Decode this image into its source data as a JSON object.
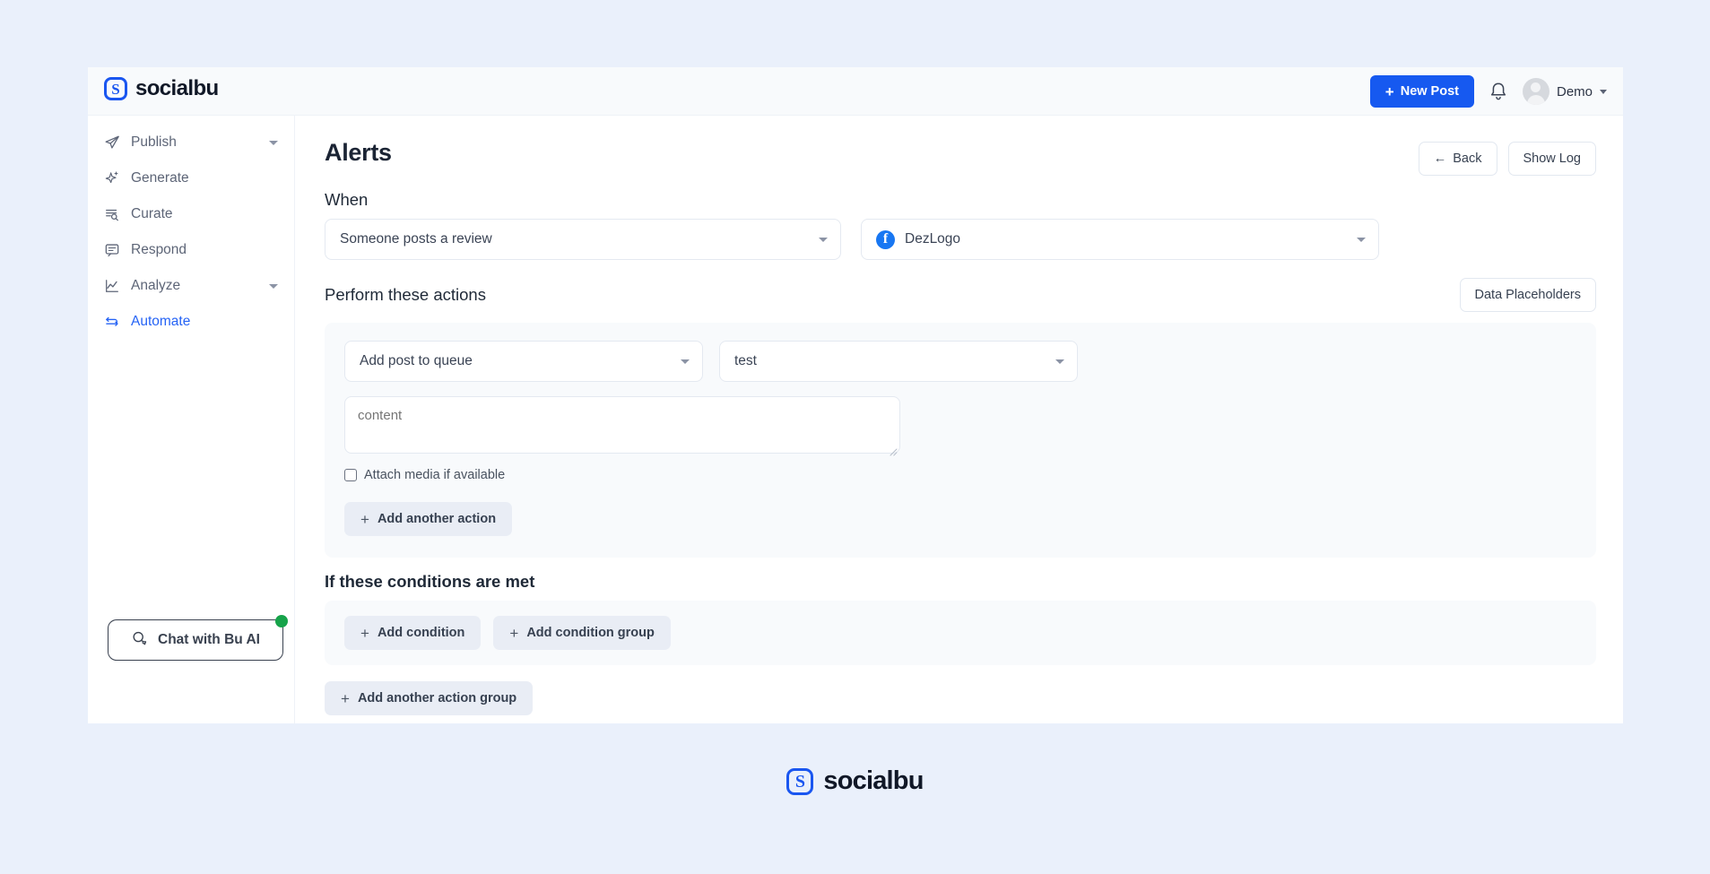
{
  "brand": {
    "name": "socialbu",
    "mark_glyph": "S"
  },
  "topbar": {
    "new_post_label": "New Post",
    "new_post_plus": "+",
    "user_name": "Demo",
    "notifications_icon": "bell-icon"
  },
  "sidebar": {
    "items": [
      {
        "label": "Publish",
        "icon": "paper-plane-icon",
        "active": false,
        "expandable": true
      },
      {
        "label": "Generate",
        "icon": "sparkle-icon",
        "active": false,
        "expandable": false
      },
      {
        "label": "Curate",
        "icon": "list-search-icon",
        "active": false,
        "expandable": false
      },
      {
        "label": "Respond",
        "icon": "chat-box-icon",
        "active": false,
        "expandable": false
      },
      {
        "label": "Analyze",
        "icon": "line-chart-icon",
        "active": false,
        "expandable": true
      },
      {
        "label": "Automate",
        "icon": "loop-arrows-icon",
        "active": true,
        "expandable": false
      }
    ],
    "chat_widget": {
      "label": "Chat with Bu AI",
      "icon": "chat-bubbles-icon",
      "status_dot_color": "#16a34a"
    }
  },
  "page": {
    "title": "Alerts",
    "back_label": "Back",
    "back_arrow": "←",
    "show_log_label": "Show Log"
  },
  "when": {
    "label": "When",
    "trigger_value": "Someone posts a review",
    "account_value": "DezLogo",
    "account_icon": "facebook-icon",
    "account_icon_glyph": "f"
  },
  "actions": {
    "label": "Perform these actions",
    "data_placeholders_label": "Data Placeholders",
    "action_value": "Add post to queue",
    "queue_value": "test",
    "content_placeholder": "content",
    "content_value": "",
    "attach_media_label": "Attach media if available",
    "attach_media_checked": false,
    "add_another_action_label": "Add another action",
    "plus": "+"
  },
  "conditions": {
    "label": "If these conditions are met",
    "add_condition_label": "Add condition",
    "add_condition_group_label": "Add condition group",
    "plus": "+"
  },
  "footer_actions": {
    "add_another_action_group_label": "Add another action group",
    "plus": "+"
  },
  "footer": {
    "brand_name": "socialbu",
    "mark_glyph": "S"
  },
  "colors": {
    "accent": "#1659f0",
    "page_background": "#eaf0fb",
    "panel_background": "#f8fafc",
    "active_nav": "#2563f5",
    "facebook": "#1877f2",
    "status_online": "#16a34a"
  }
}
